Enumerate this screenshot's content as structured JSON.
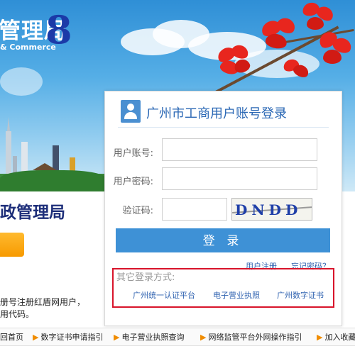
{
  "header": {
    "title_cn": "管理局",
    "title_en": "& Commerce",
    "logo_mark": "8"
  },
  "left": {
    "title": "政管理局",
    "note_line1": "册号注册红盾网用户，",
    "note_line2": "用代码。"
  },
  "login": {
    "title": "广州市工商用户账号登录",
    "account_label": "用户账号:",
    "password_label": "用户密码:",
    "captcha_label": "验证码:",
    "account_value": "",
    "password_value": "",
    "captcha_value": "",
    "captcha_text": "DNDD",
    "login_button": "登 录",
    "register_link": "用户注册",
    "forgot_link": "忘记密码？"
  },
  "other_login": {
    "title": "其它登录方式:",
    "methods": [
      "广州统一认证平台",
      "电子营业执照",
      "广州数字证书"
    ]
  },
  "bottom_nav": {
    "items": [
      "回首页",
      "数字证书申请指引",
      "电子营业执照查询",
      "网络监管平台外网操作指引",
      "加入收藏"
    ]
  },
  "colors": {
    "accent": "#3e91d6",
    "highlight_border": "#d8142b",
    "title_blue": "#2b68b5"
  },
  "icons": {
    "user": "user-icon",
    "nav_arrow": "arrow-right-icon"
  }
}
